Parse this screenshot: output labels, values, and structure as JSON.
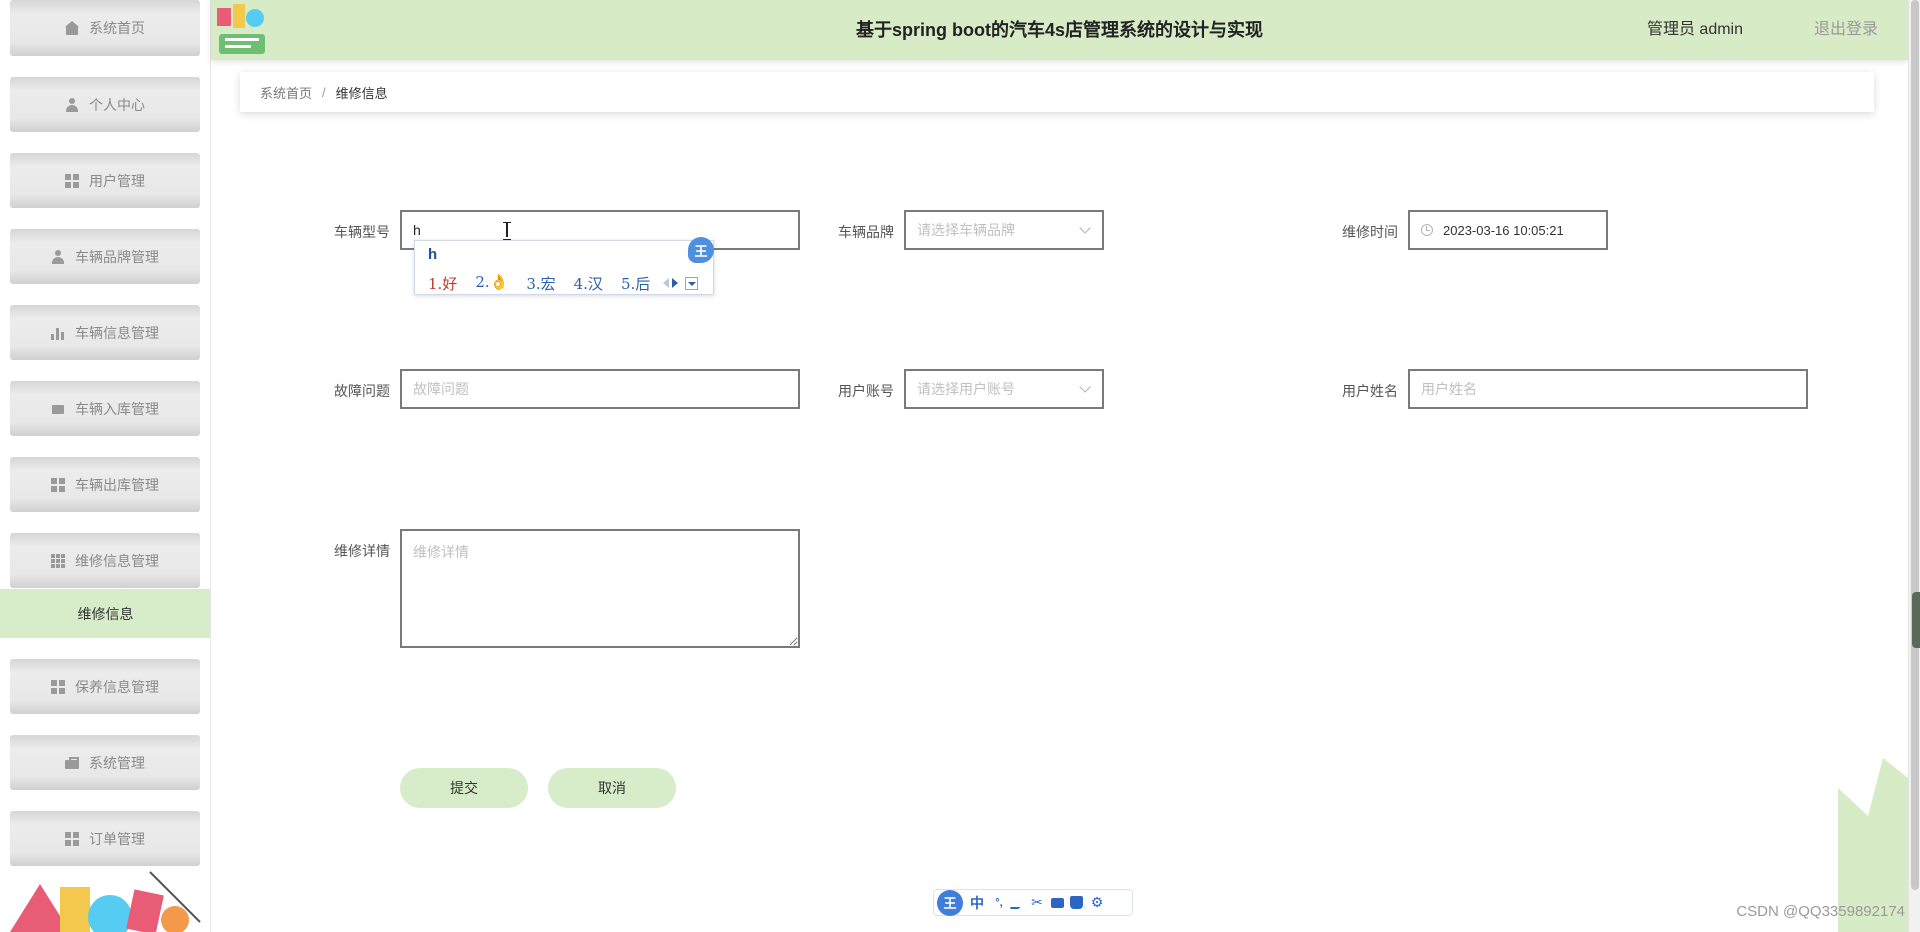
{
  "app": {
    "title": "基于spring boot的汽车4s店管理系统的设计与实现",
    "user_label": "管理员 admin",
    "logout_label": "退出登录"
  },
  "sidebar": {
    "items": [
      {
        "label": "系统首页",
        "icon": "home-icon"
      },
      {
        "label": "个人中心",
        "icon": "user-icon"
      },
      {
        "label": "用户管理",
        "icon": "grid-icon"
      },
      {
        "label": "车辆品牌管理",
        "icon": "user-icon"
      },
      {
        "label": "车辆信息管理",
        "icon": "bar-chart-icon"
      },
      {
        "label": "车辆入库管理",
        "icon": "box-icon"
      },
      {
        "label": "车辆出库管理",
        "icon": "grid-icon"
      },
      {
        "label": "维修信息管理",
        "icon": "grid9-icon"
      },
      {
        "label": "保养信息管理",
        "icon": "grid-icon"
      },
      {
        "label": "系统管理",
        "icon": "briefcase-icon"
      },
      {
        "label": "订单管理",
        "icon": "grid-icon"
      }
    ],
    "active_subitem": "维修信息"
  },
  "breadcrumb": {
    "home": "系统首页",
    "separator": "/",
    "current": "维修信息"
  },
  "form": {
    "vehicle_model": {
      "label": "车辆型号",
      "value": "h"
    },
    "vehicle_brand": {
      "label": "车辆品牌",
      "placeholder": "请选择车辆品牌"
    },
    "repair_time": {
      "label": "维修时间",
      "value": "2023-03-16 10:05:21"
    },
    "fault_issue": {
      "label": "故障问题",
      "placeholder": "故障问题"
    },
    "user_account": {
      "label": "用户账号",
      "placeholder": "请选择用户账号"
    },
    "user_name": {
      "label": "用户姓名",
      "placeholder": "用户姓名"
    },
    "repair_details": {
      "label": "维修详情",
      "placeholder": "维修详情"
    },
    "submit_label": "提交",
    "cancel_label": "取消"
  },
  "ime": {
    "input": "h",
    "badge": "王",
    "candidates": [
      "1.好",
      "2.👌",
      "3.宏",
      "4.汉",
      "5.后"
    ],
    "toolbar": {
      "logo": "王",
      "mode": "中",
      "punct": "°,"
    }
  },
  "watermark": "CSDN @QQ3359892174",
  "colors": {
    "header_bg": "#d7ebc6",
    "active_menu_bg": "#d7ecc9",
    "button_bg": "#d7ecc9",
    "ime_blue": "#3f7fdc"
  }
}
